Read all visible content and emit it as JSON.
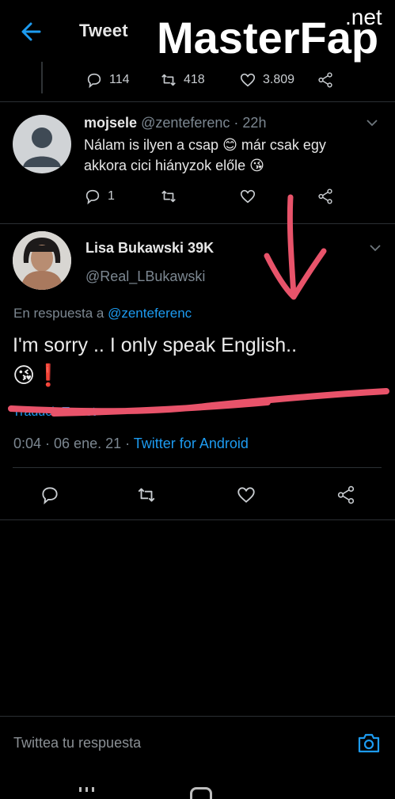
{
  "header": {
    "title": "Tweet",
    "watermark_main": "MasterFap",
    "watermark_tld": ".net"
  },
  "top_tweet_actions": {
    "replies": "114",
    "retweets": "418",
    "likes": "3.809"
  },
  "reply_tweet": {
    "name": "mojsele",
    "handle": "@zenteferenc",
    "time": "· 22h",
    "text_line1": "Nálam is ilyen a csap 😊 már csak egy",
    "text_line2": "akkora cici hiányzok előle 😘",
    "replies": "1"
  },
  "main_tweet": {
    "name": "Lisa Bukawski 39K",
    "handle": "@Real_LBukawski",
    "reply_prefix": "En respuesta a",
    "reply_to": "@zenteferenc",
    "text_line1": "I'm sorry .. I only speak English..",
    "text_line2": "😘❗",
    "translate": "Traducir Tweet",
    "timestamp": "0:04 · 06 ene. 21 ·",
    "source": "Twitter for Android"
  },
  "reply_bar": {
    "placeholder": "Twittea tu respuesta"
  },
  "colors": {
    "background": "#000000",
    "link": "#1d9bf0",
    "annotation": "#e8536a"
  }
}
